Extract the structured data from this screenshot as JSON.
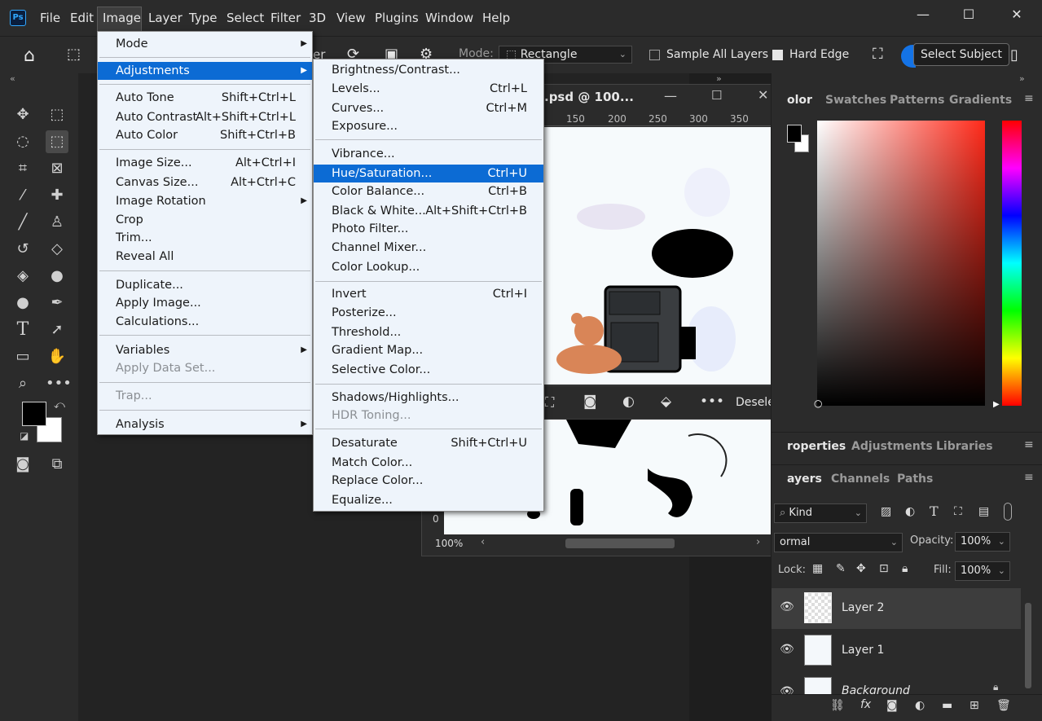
{
  "menubar": {
    "items": [
      "File",
      "Edit",
      "Image",
      "Layer",
      "Type",
      "Select",
      "Filter",
      "3D",
      "View",
      "Plugins",
      "Window",
      "Help"
    ],
    "logo": "Ps",
    "controls": [
      "—",
      "☐",
      "✕"
    ]
  },
  "options": {
    "mode_label": "Mode:",
    "mode_value": "Rectangle",
    "sample_all_layers": "Sample All Layers",
    "hard_edge": "Hard Edge",
    "select_subject": "Select Subject",
    "partial_text": "er"
  },
  "image_menu": [
    {
      "label": "Mode",
      "submenu": true
    },
    {
      "sep": true
    },
    {
      "label": "Adjustments",
      "submenu": true,
      "highlight": true
    },
    {
      "sep": true
    },
    {
      "label": "Auto Tone",
      "shortcut": "Shift+Ctrl+L"
    },
    {
      "label": "Auto Contrast",
      "shortcut": "Alt+Shift+Ctrl+L"
    },
    {
      "label": "Auto Color",
      "shortcut": "Shift+Ctrl+B"
    },
    {
      "sep": true
    },
    {
      "label": "Image Size...",
      "shortcut": "Alt+Ctrl+I"
    },
    {
      "label": "Canvas Size...",
      "shortcut": "Alt+Ctrl+C"
    },
    {
      "label": "Image Rotation",
      "submenu": true
    },
    {
      "label": "Crop"
    },
    {
      "label": "Trim..."
    },
    {
      "label": "Reveal All"
    },
    {
      "sep": true
    },
    {
      "label": "Duplicate..."
    },
    {
      "label": "Apply Image..."
    },
    {
      "label": "Calculations..."
    },
    {
      "sep": true
    },
    {
      "label": "Variables",
      "submenu": true
    },
    {
      "label": "Apply Data Set...",
      "disabled": true
    },
    {
      "sep": true
    },
    {
      "label": "Trap...",
      "disabled": true
    },
    {
      "sep": true
    },
    {
      "label": "Analysis",
      "submenu": true
    }
  ],
  "adjust_menu": [
    {
      "label": "Brightness/Contrast..."
    },
    {
      "label": "Levels...",
      "shortcut": "Ctrl+L"
    },
    {
      "label": "Curves...",
      "shortcut": "Ctrl+M"
    },
    {
      "label": "Exposure..."
    },
    {
      "sep": true
    },
    {
      "label": "Vibrance..."
    },
    {
      "label": "Hue/Saturation...",
      "shortcut": "Ctrl+U",
      "highlight": true
    },
    {
      "label": "Color Balance...",
      "shortcut": "Ctrl+B"
    },
    {
      "label": "Black & White...",
      "shortcut": "Alt+Shift+Ctrl+B"
    },
    {
      "label": "Photo Filter..."
    },
    {
      "label": "Channel Mixer..."
    },
    {
      "label": "Color Lookup..."
    },
    {
      "sep": true
    },
    {
      "label": "Invert",
      "shortcut": "Ctrl+I"
    },
    {
      "label": "Posterize..."
    },
    {
      "label": "Threshold..."
    },
    {
      "label": "Gradient Map..."
    },
    {
      "label": "Selective Color..."
    },
    {
      "sep": true
    },
    {
      "label": "Shadows/Highlights..."
    },
    {
      "label": "HDR Toning...",
      "disabled": true
    },
    {
      "sep": true
    },
    {
      "label": "Desaturate",
      "shortcut": "Shift+Ctrl+U"
    },
    {
      "label": "Match Color..."
    },
    {
      "label": "Replace Color..."
    },
    {
      "label": "Equalize..."
    }
  ],
  "document": {
    "title": ".psd @ 100...",
    "ruler": [
      "150",
      "200",
      "250",
      "300",
      "350"
    ],
    "zoom": "100%",
    "ruler_v": "0",
    "deselect": "Deselect"
  },
  "color_panel": {
    "tabs": [
      "olor",
      "Swatches",
      "Patterns",
      "Gradients"
    ]
  },
  "props_panel": {
    "tabs": [
      "roperties",
      "Adjustments",
      "Libraries"
    ]
  },
  "layers_panel": {
    "tabs": [
      "ayers",
      "Channels",
      "Paths"
    ],
    "kind": "Kind",
    "blend_mode": "ormal",
    "opacity_label": "Opacity:",
    "opacity_value": "100%",
    "lock_label": "Lock:",
    "fill_label": "Fill:",
    "fill_value": "100%",
    "layers": [
      {
        "name": "Layer 2",
        "selected": true
      },
      {
        "name": "Layer 1"
      },
      {
        "name": "Background"
      }
    ]
  },
  "colors": {
    "accent": "#0c6bd4",
    "menu_bg": "#eef4fb",
    "chrome": "#2b2b2b"
  }
}
